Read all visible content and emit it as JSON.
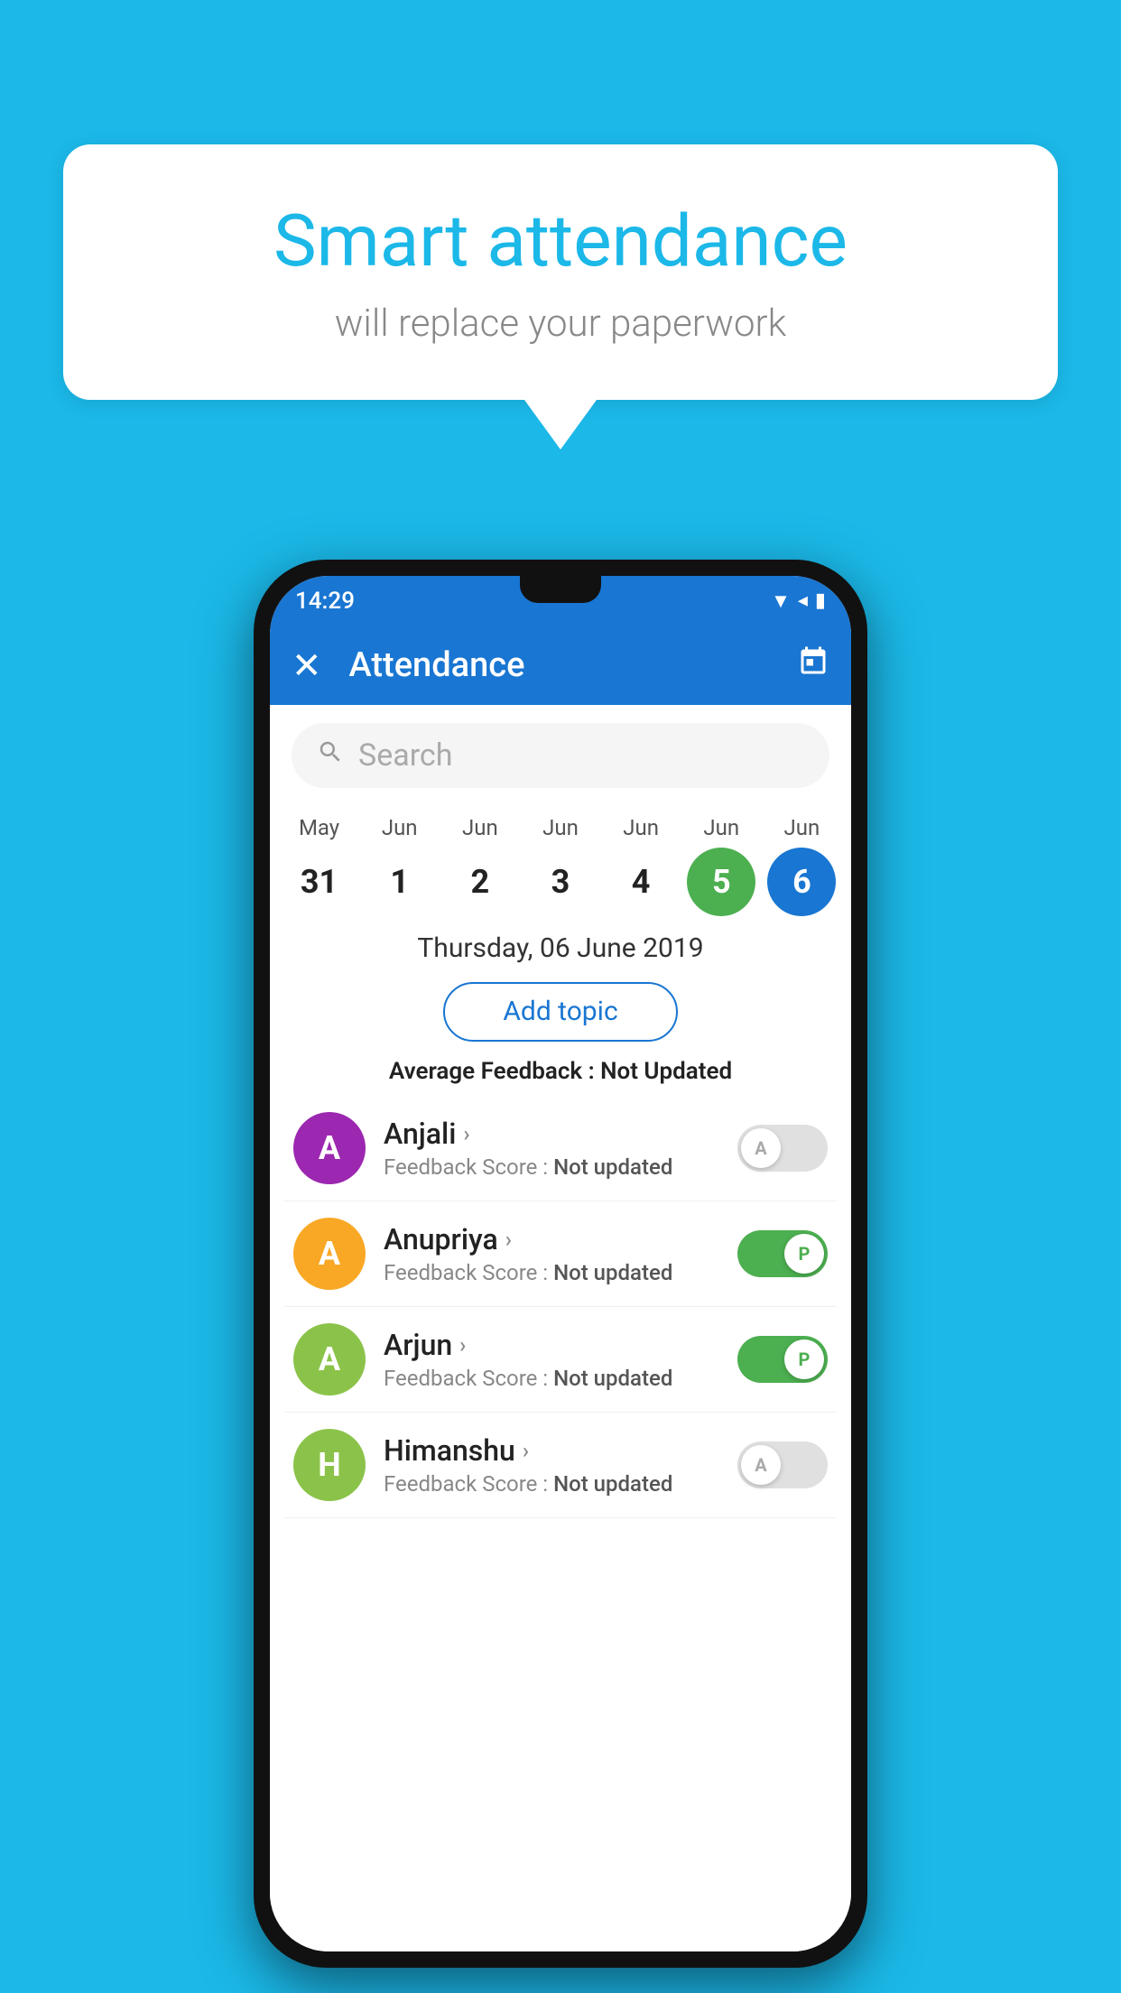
{
  "background_color": "#1bb8e8",
  "speech_bubble": {
    "title": "Smart attendance",
    "subtitle": "will replace your paperwork"
  },
  "status_bar": {
    "time": "14:29",
    "icons": [
      "▼",
      "◀",
      "▮"
    ]
  },
  "app_bar": {
    "close_icon": "✕",
    "title": "Attendance",
    "calendar_icon": "📅"
  },
  "search": {
    "placeholder": "Search"
  },
  "calendar": {
    "days": [
      {
        "month": "May",
        "date": "31",
        "state": "normal"
      },
      {
        "month": "Jun",
        "date": "1",
        "state": "normal"
      },
      {
        "month": "Jun",
        "date": "2",
        "state": "normal"
      },
      {
        "month": "Jun",
        "date": "3",
        "state": "normal"
      },
      {
        "month": "Jun",
        "date": "4",
        "state": "normal"
      },
      {
        "month": "Jun",
        "date": "5",
        "state": "active-green"
      },
      {
        "month": "Jun",
        "date": "6",
        "state": "active-blue"
      }
    ]
  },
  "selected_date": "Thursday, 06 June 2019",
  "add_topic_label": "Add topic",
  "avg_feedback_label": "Average Feedback :",
  "avg_feedback_value": "Not Updated",
  "students": [
    {
      "name": "Anjali",
      "feedback_label": "Feedback Score :",
      "feedback_value": "Not updated",
      "avatar_letter": "A",
      "avatar_color": "#9c27b0",
      "toggle_state": "off",
      "toggle_letter": "A"
    },
    {
      "name": "Anupriya",
      "feedback_label": "Feedback Score :",
      "feedback_value": "Not updated",
      "avatar_letter": "A",
      "avatar_color": "#f9a825",
      "toggle_state": "on",
      "toggle_letter": "P"
    },
    {
      "name": "Arjun",
      "feedback_label": "Feedback Score :",
      "feedback_value": "Not updated",
      "avatar_letter": "A",
      "avatar_color": "#8bc34a",
      "toggle_state": "on",
      "toggle_letter": "P"
    },
    {
      "name": "Himanshu",
      "feedback_label": "Feedback Score :",
      "feedback_value": "Not updated",
      "avatar_letter": "H",
      "avatar_color": "#8bc34a",
      "toggle_state": "off",
      "toggle_letter": "A"
    }
  ]
}
